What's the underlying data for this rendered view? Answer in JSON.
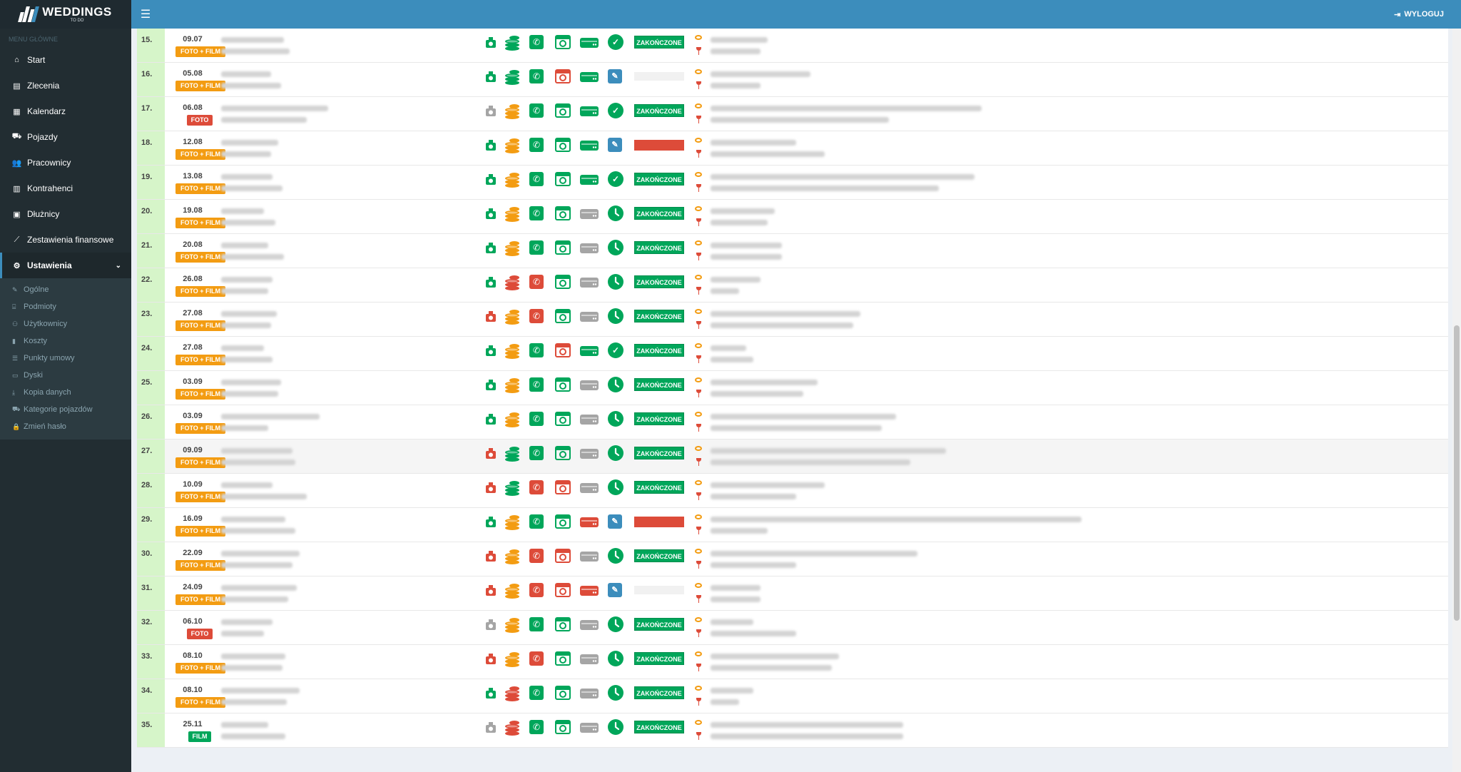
{
  "app": {
    "name": "WEDDINGS",
    "sub": "TO DO"
  },
  "header": {
    "logout_label": "WYLOGUJ"
  },
  "sidebar": {
    "menu_header": "MENU GŁÓWNE",
    "items": [
      {
        "label": "Start",
        "icon": "home-icon"
      },
      {
        "label": "Zlecenia",
        "icon": "file-icon"
      },
      {
        "label": "Kalendarz",
        "icon": "calendar-icon"
      },
      {
        "label": "Pojazdy",
        "icon": "car-icon"
      },
      {
        "label": "Pracownicy",
        "icon": "users-icon"
      },
      {
        "label": "Kontrahenci",
        "icon": "building-icon"
      },
      {
        "label": "Dłużnicy",
        "icon": "money-icon"
      },
      {
        "label": "Zestawienia finansowe",
        "icon": "chart-icon"
      },
      {
        "label": "Ustawienia",
        "icon": "gear-icon"
      }
    ],
    "submenu": [
      {
        "label": "Ogólne",
        "icon": "wrench-icon"
      },
      {
        "label": "Podmioty",
        "icon": "bank-icon"
      },
      {
        "label": "Użytkownicy",
        "icon": "user-plus-icon"
      },
      {
        "label": "Koszty",
        "icon": "bar-chart-icon"
      },
      {
        "label": "Punkty umowy",
        "icon": "list-icon"
      },
      {
        "label": "Dyski",
        "icon": "hdd-icon"
      },
      {
        "label": "Kopia danych",
        "icon": "download-icon"
      },
      {
        "label": "Kategorie pojazdów",
        "icon": "car-icon"
      },
      {
        "label": "Zmień hasło",
        "icon": "lock-icon"
      }
    ]
  },
  "colors": {
    "green": "#00a65a",
    "red": "#dd4b39",
    "orange": "#f39c12",
    "gray": "#a5a5a5",
    "blue": "#3c8dbc"
  },
  "badge_done": "ZAKOŃCZONE",
  "rows": [
    {
      "n": "15.",
      "date": "09.07",
      "type": "FOTO + FILM",
      "cam": "green",
      "money": "green",
      "phone": "green",
      "clock": "green",
      "drive": "green",
      "status": "check",
      "badge": "done"
    },
    {
      "n": "16.",
      "date": "05.08",
      "type": "FOTO + FILM",
      "cam": "green",
      "money": "green",
      "phone": "green",
      "clock": "red",
      "drive": "green",
      "status": "edit",
      "badge": "empty"
    },
    {
      "n": "17.",
      "date": "06.08",
      "type": "FOTO",
      "cam": "gray",
      "money": "orange",
      "phone": "green",
      "clock": "green",
      "drive": "green",
      "status": "check",
      "badge": "done"
    },
    {
      "n": "18.",
      "date": "12.08",
      "type": "FOTO + FILM",
      "cam": "green",
      "money": "orange",
      "phone": "green",
      "clock": "green",
      "drive": "green",
      "status": "edit",
      "badge": "red"
    },
    {
      "n": "19.",
      "date": "13.08",
      "type": "FOTO + FILM",
      "cam": "green",
      "money": "orange",
      "phone": "green",
      "clock": "green",
      "drive": "green",
      "status": "check",
      "badge": "done"
    },
    {
      "n": "20.",
      "date": "19.08",
      "type": "FOTO + FILM",
      "cam": "green",
      "money": "orange",
      "phone": "green",
      "clock": "green",
      "drive": "gray",
      "status": "clock",
      "badge": "done"
    },
    {
      "n": "21.",
      "date": "20.08",
      "type": "FOTO + FILM",
      "cam": "green",
      "money": "orange",
      "phone": "green",
      "clock": "green",
      "drive": "gray",
      "status": "clock",
      "badge": "done"
    },
    {
      "n": "22.",
      "date": "26.08",
      "type": "FOTO + FILM",
      "cam": "green",
      "money": "red",
      "phone": "red",
      "clock": "green",
      "drive": "gray",
      "status": "clock",
      "badge": "done"
    },
    {
      "n": "23.",
      "date": "27.08",
      "type": "FOTO + FILM",
      "cam": "red",
      "money": "orange",
      "phone": "red",
      "clock": "green",
      "drive": "gray",
      "status": "clock",
      "badge": "done"
    },
    {
      "n": "24.",
      "date": "27.08",
      "type": "FOTO + FILM",
      "cam": "green",
      "money": "orange",
      "phone": "green",
      "clock": "red",
      "drive": "green",
      "status": "check",
      "badge": "done"
    },
    {
      "n": "25.",
      "date": "03.09",
      "type": "FOTO + FILM",
      "cam": "green",
      "money": "orange",
      "phone": "green",
      "clock": "green",
      "drive": "gray",
      "status": "clock",
      "badge": "done"
    },
    {
      "n": "26.",
      "date": "03.09",
      "type": "FOTO + FILM",
      "cam": "green",
      "money": "orange",
      "phone": "green",
      "clock": "green",
      "drive": "gray",
      "status": "clock",
      "badge": "done"
    },
    {
      "n": "27.",
      "date": "09.09",
      "type": "FOTO + FILM",
      "cam": "red",
      "money": "green",
      "phone": "green",
      "clock": "green",
      "drive": "gray",
      "status": "clock",
      "badge": "done",
      "hl": true
    },
    {
      "n": "28.",
      "date": "10.09",
      "type": "FOTO + FILM",
      "cam": "red",
      "money": "green",
      "phone": "red",
      "clock": "red",
      "drive": "gray",
      "status": "clock",
      "badge": "done"
    },
    {
      "n": "29.",
      "date": "16.09",
      "type": "FOTO + FILM",
      "cam": "green",
      "money": "orange",
      "phone": "green",
      "clock": "green",
      "drive": "red",
      "status": "edit",
      "badge": "red"
    },
    {
      "n": "30.",
      "date": "22.09",
      "type": "FOTO + FILM",
      "cam": "red",
      "money": "orange",
      "phone": "red",
      "clock": "red",
      "drive": "gray",
      "status": "clock",
      "badge": "done"
    },
    {
      "n": "31.",
      "date": "24.09",
      "type": "FOTO + FILM",
      "cam": "red",
      "money": "orange",
      "phone": "red",
      "clock": "red",
      "drive": "red",
      "status": "edit",
      "badge": "empty"
    },
    {
      "n": "32.",
      "date": "06.10",
      "type": "FOTO",
      "cam": "gray",
      "money": "orange",
      "phone": "green",
      "clock": "green",
      "drive": "gray",
      "status": "clock",
      "badge": "done"
    },
    {
      "n": "33.",
      "date": "08.10",
      "type": "FOTO + FILM",
      "cam": "red",
      "money": "orange",
      "phone": "red",
      "clock": "green",
      "drive": "gray",
      "status": "clock",
      "badge": "done"
    },
    {
      "n": "34.",
      "date": "08.10",
      "type": "FOTO + FILM",
      "cam": "green",
      "money": "red",
      "phone": "green",
      "clock": "green",
      "drive": "gray",
      "status": "clock",
      "badge": "done"
    },
    {
      "n": "35.",
      "date": "25.11",
      "type": "FILM",
      "cam": "gray",
      "money": "red",
      "phone": "green",
      "clock": "green",
      "drive": "gray",
      "status": "clock",
      "badge": "done"
    }
  ]
}
